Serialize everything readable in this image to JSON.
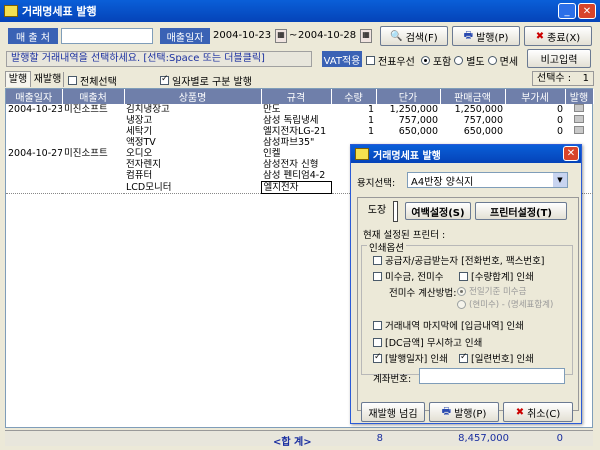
{
  "window": {
    "title": "거래명세표 발행"
  },
  "toolbar": {
    "customer_label": "매 출 처",
    "customer_value": "",
    "sales_date_label": "매출일자",
    "date_from": "2004-10-23",
    "date_sep": "~",
    "date_to": "2004-10-28",
    "search_btn": "검색(F)",
    "issue_btn": "발행(P)",
    "exit_btn": "종료(X)"
  },
  "instruction": "발행할 거래내역을 선택하세요. [선택:Space 또는 더블클릭]",
  "vat": {
    "label": "VAT적용",
    "check_label": "전표우선",
    "opt1": "포함",
    "opt2": "별도",
    "opt3": "면세"
  },
  "memo_btn": "비고입력",
  "tabs": {
    "issued": "발행",
    "reissue": "재발행"
  },
  "select_all": "전체선택",
  "split_by_date": "일자별로 구분 발행",
  "selected_count_label": "선택수 :",
  "selected_count": "1",
  "grid": {
    "headers": [
      "매출일자",
      "매출처",
      "상품명",
      "규격",
      "수량",
      "단가",
      "판매금액",
      "부가세",
      "발행"
    ],
    "rows": [
      [
        "2004-10-23",
        "미진소프트",
        "김치냉장고",
        "만도",
        "1",
        "1,250,000",
        "1,250,000",
        "0"
      ],
      [
        "",
        "",
        "냉장고",
        "삼성 독립냉세",
        "1",
        "757,000",
        "757,000",
        "0"
      ],
      [
        "",
        "",
        "세탁기",
        "엘지전자LG-21",
        "1",
        "650,000",
        "650,000",
        "0"
      ],
      [
        "",
        "",
        "액정TV",
        "삼성파브35\"",
        "",
        "",
        "",
        ""
      ],
      [
        "2004-10-27",
        "미진소프트",
        "오디오",
        "인켈",
        "",
        "",
        "",
        ""
      ],
      [
        "",
        "",
        "전자렌지",
        "삼성전자 신형",
        "",
        "",
        "",
        ""
      ],
      [
        "",
        "",
        "컴퓨터",
        "삼성 펜티엄4-2",
        "",
        "",
        "",
        ""
      ],
      [
        "",
        "",
        "LCD모니터",
        "엘지전자",
        "",
        "",
        "",
        ""
      ]
    ]
  },
  "footer": {
    "label": "<합 계>",
    "qty": "8",
    "amount": "8,457,000",
    "vat": "0"
  },
  "dialog": {
    "title": "거래명세표 발행",
    "paper_label": "용지선택:",
    "paper_value": "A4반장 양식지",
    "tab_stamp": "도장",
    "margin_btn": "여백설정(S)",
    "printer_btn": "프린터설정(T)",
    "current_printer": "현재 설정된 프린터 :",
    "print_options": "인쇄옵션",
    "opt_supplier": "공급자/공급받는자 [전화번호, 팩스번호]",
    "opt_unpaid": "미수금, 전미수",
    "opt_qty_total": "[수량합계] 인쇄",
    "unpaid_method": "전미수 계산방법:",
    "method1": "전일기준 미수금",
    "method2": "(현미수) - (명세표합계)",
    "opt_last_entry": "거래내역 마지막에 [입금내역] 인쇄",
    "opt_dc": "[DC금액] 무시하고 인쇄",
    "opt_issue_date": "[발행일자] 인쇄",
    "opt_serial": "[일련번호] 인쇄",
    "account_label": "계좌번호:",
    "account_value": "",
    "reissue_btn": "재발행 넘김",
    "issue_btn": "발행(P)",
    "cancel_btn": "취소(C)"
  }
}
